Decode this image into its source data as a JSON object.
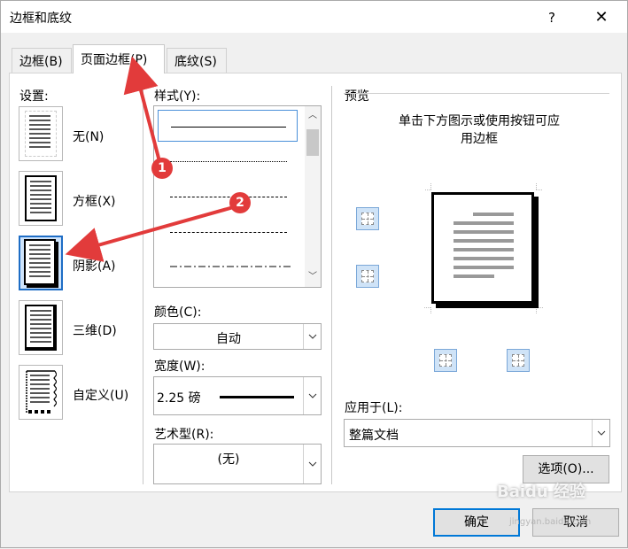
{
  "window": {
    "title": "边框和底纹",
    "help": "?",
    "close": "✕"
  },
  "tabs": [
    {
      "label": "边框(B)"
    },
    {
      "label": "页面边框(P)"
    },
    {
      "label": "底纹(S)"
    }
  ],
  "settings": {
    "header": "设置:",
    "items": [
      {
        "label": "无(N)"
      },
      {
        "label": "方框(X)"
      },
      {
        "label": "阴影(A)"
      },
      {
        "label": "三维(D)"
      },
      {
        "label": "自定义(U)"
      }
    ]
  },
  "style": {
    "header": "样式(Y):"
  },
  "color": {
    "label": "颜色(C):",
    "value": "自动"
  },
  "width": {
    "label": "宽度(W):",
    "value": "2.25 磅"
  },
  "art": {
    "label": "艺术型(R):",
    "value": "(无)"
  },
  "preview": {
    "header": "预览",
    "hint_line1": "单击下方图示或使用按钮可应",
    "hint_line2": "用边框"
  },
  "apply": {
    "label": "应用于(L):",
    "value": "整篇文档"
  },
  "buttons": {
    "options": "选项(O)...",
    "ok": "确定",
    "cancel": "取消"
  },
  "annotations": {
    "one": "1",
    "two": "2"
  },
  "watermark": {
    "main": "Baidu 经验",
    "sub": "jingyan.baidu.com"
  },
  "accent_color": "#e23b3b"
}
